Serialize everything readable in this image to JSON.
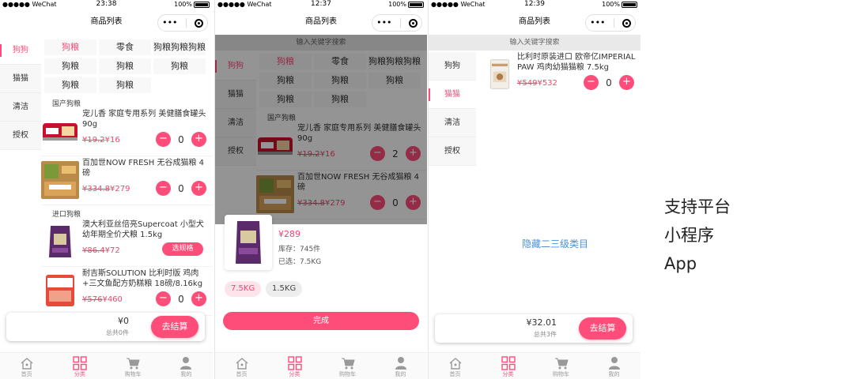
{
  "screens": [
    {
      "status": {
        "carrier": "●●●●● WeChat",
        "time": "23:38",
        "battery": "100%"
      },
      "title": "商品列表",
      "capsule": {
        "more": "•••"
      },
      "categories": [
        "狗狗",
        "猫猫",
        "清洁",
        "授权"
      ],
      "tags": [
        "狗粮",
        "零食",
        "狗粮狗粮狗粮",
        "狗粮",
        "狗粮",
        "狗粮",
        "狗粮",
        "狗粮"
      ],
      "section1": "国产狗粮",
      "section2": "进口狗粮",
      "products": [
        {
          "name": "宠儿香 家庭专用系列 美健膳食罐头 90g",
          "old_price": "¥19.2",
          "price": "¥16",
          "qty": "0"
        },
        {
          "name": "百加世NOW FRESH 无谷成猫粮 4磅",
          "old_price": "¥334.8",
          "price": "¥279",
          "qty": "0"
        },
        {
          "name": "澳大利亚丝倍亮Supercoat 小型犬幼年期全价犬粮 1.5kg",
          "old_price": "¥86.4",
          "price": "¥72",
          "spec_label": "选规格"
        },
        {
          "name": "耐吉斯SOLUTION 比利时版 鸡肉+三文鱼配方奶糕粮 18磅/8.16kg",
          "old_price": "¥576",
          "price": "¥460",
          "qty": "0"
        }
      ],
      "cart": {
        "total": "¥0",
        "count": "总共0件",
        "checkout": "去结算"
      }
    },
    {
      "status": {
        "carrier": "●●●●● WeChat",
        "time": "12:37",
        "battery": "100%"
      },
      "title": "商品列表",
      "capsule": {
        "more": "•••"
      },
      "search_placeholder": "输入关键字搜索",
      "categories": [
        "狗狗",
        "猫猫",
        "清洁",
        "授权"
      ],
      "tags": [
        "狗粮",
        "零食",
        "狗粮狗粮狗粮",
        "狗粮",
        "狗粮",
        "狗粮",
        "狗粮",
        "狗粮"
      ],
      "section1": "国产狗粮",
      "products": [
        {
          "name": "宠儿香 家庭专用系列 美健膳食罐头 90g",
          "old_price": "¥19.2",
          "price": "¥16",
          "qty": "2"
        },
        {
          "name": "百加世NOW FRESH 无谷成猫粮 4磅",
          "old_price": "¥334.8",
          "price": "¥279",
          "qty": "0"
        }
      ],
      "sheet": {
        "price": "¥289",
        "stock": "库存：745件",
        "selected": "已选：7.5KG",
        "options": [
          "7.5KG",
          "1.5KG"
        ],
        "done": "完成"
      }
    },
    {
      "status": {
        "carrier": "●●●●● WeChat",
        "time": "12:39",
        "battery": "100%"
      },
      "title": "商品列表",
      "capsule": {
        "more": "•••"
      },
      "search_placeholder": "输入关键字搜索",
      "categories": [
        "狗狗",
        "猫猫",
        "清洁",
        "授权"
      ],
      "product": {
        "name": "比利时原装进口 欧帝亿IMPERIAL PAW 鸡肉幼猫猫粮 7.5kg",
        "old_price": "¥549",
        "price": "¥532",
        "qty": "0"
      },
      "hide_link": "隐藏二三级类目",
      "cart": {
        "total": "¥32.01",
        "count": "总共3件",
        "checkout": "去结算"
      }
    }
  ],
  "tabbar": [
    {
      "label": "首页",
      "icon": "home-icon"
    },
    {
      "label": "分类",
      "icon": "category-icon"
    },
    {
      "label": "购物车",
      "icon": "cart-icon"
    },
    {
      "label": "我的",
      "icon": "user-icon"
    }
  ],
  "side_text": {
    "line1": "支持平台",
    "line2": "小程序",
    "line3": "App"
  },
  "colors": {
    "accent": "#ff4d7a",
    "price": "#ff3f6c",
    "link": "#4a90d9"
  }
}
